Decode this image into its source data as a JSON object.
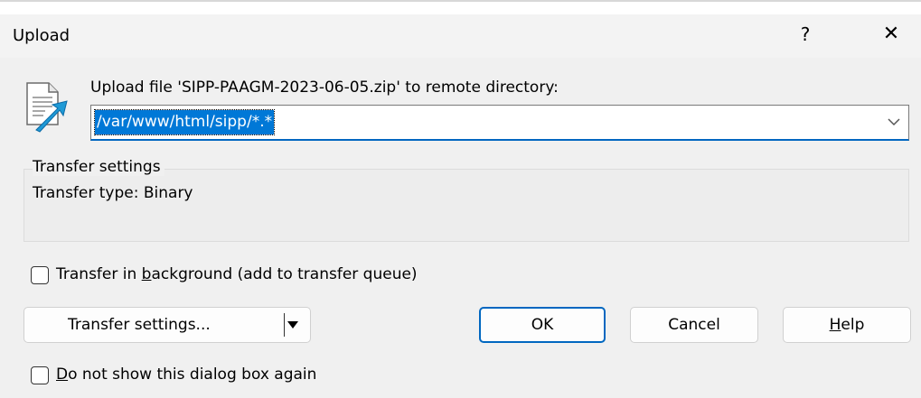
{
  "window": {
    "title": "Upload",
    "help_glyph": "?",
    "close_glyph": "✕"
  },
  "upload": {
    "label": "Upload file 'SIPP-PAAGM-2023-06-05.zip' to remote directory:",
    "remote_path": "/var/www/html/sipp/*.*"
  },
  "transfer_group": {
    "legend": "Transfer settings",
    "type_text": "Transfer type: Binary"
  },
  "options": {
    "background_label_pre": "Transfer in ",
    "background_label_key": "b",
    "background_label_post": "ackground (add to transfer queue)",
    "background_checked": false,
    "dont_show_key": "D",
    "dont_show_post": "o not show this dialog box again",
    "dont_show_checked": false
  },
  "buttons": {
    "transfer_settings": "Transfer settings...",
    "ok": "OK",
    "cancel": "Cancel",
    "help_key": "H",
    "help_post": "elp"
  },
  "colors": {
    "accent": "#0067c0",
    "selection": "#0078d7"
  }
}
